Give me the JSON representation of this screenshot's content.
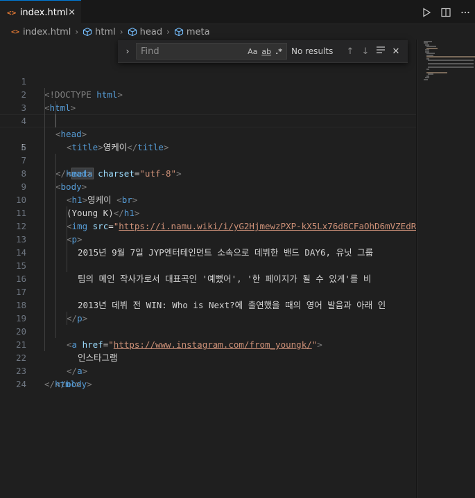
{
  "tab": {
    "icon": "<>",
    "label": "index.html",
    "close": "✕"
  },
  "breadcrumb": [
    "index.html",
    "html",
    "head",
    "meta"
  ],
  "find": {
    "placeholder": "Find",
    "match_case": "Aa",
    "whole_word": "ab",
    "regex": ".*",
    "status": "No results"
  },
  "lines": [
    {
      "n": "1"
    },
    {
      "n": "2"
    },
    {
      "n": "3"
    },
    {
      "n": "4"
    },
    {
      "n": "5"
    },
    {
      "n": "6"
    },
    {
      "n": "7"
    },
    {
      "n": "8"
    },
    {
      "n": "9"
    },
    {
      "n": "10"
    },
    {
      "n": "11"
    },
    {
      "n": "12"
    },
    {
      "n": "13"
    },
    {
      "n": "14"
    },
    {
      "n": "15"
    },
    {
      "n": "16"
    },
    {
      "n": "17"
    },
    {
      "n": "18"
    },
    {
      "n": "19"
    },
    {
      "n": "20"
    },
    {
      "n": "21"
    },
    {
      "n": "22"
    },
    {
      "n": "23"
    },
    {
      "n": "24"
    }
  ],
  "code": {
    "l1_doctype": "<!DOCTYPE ",
    "l1_html": "html",
    "l1_close": ">",
    "l2_open": "<",
    "l2_tag": "html",
    "l2_close": ">",
    "l3_open": "<",
    "l3_tag": "head",
    "l3_close": ">",
    "l4_open": "<",
    "l4_tag": "title",
    "l4_close": ">",
    "l4_text": "영케이",
    "l4_end_open": "</",
    "l4_end_tag": "title",
    "l4_end_close": ">",
    "l5_open": "<",
    "l5_tag": "meta",
    "l5_attr": "charset",
    "l5_eq": "=",
    "l5_val": "\"utf-8\"",
    "l5_close": ">",
    "l6_open": "</",
    "l6_tag": "head",
    "l6_close": ">",
    "l7_open": "<",
    "l7_tag": "body",
    "l7_close": ">",
    "l8_open": "<",
    "l8_tag": "h1",
    "l8_close": ">",
    "l8_text": "영케이 ",
    "l8_br_open": "<",
    "l8_br_tag": "br",
    "l8_br_close": ">",
    "l9_text": "(Young K)",
    "l9_end_open": "</",
    "l9_end_tag": "h1",
    "l9_end_close": ">",
    "l10_open": "<",
    "l10_tag": "img",
    "l10_attr": "src",
    "l10_eq": "=",
    "l10_url": "https://i.namu.wiki/i/yG2HjmewzPXP-kX5Lx76d8CFaOhD6mVZEdR",
    "l11_open": "<",
    "l11_tag": "p",
    "l11_close": ">",
    "l12_text": "2015년 9월 7일 JYP엔터테인먼트 소속으로 데뷔한 밴드 DAY6, 유닛 그룹",
    "l14_text": "팀의 메인 작사가로서 대표곡인 '예뻤어', '한 페이지가 될 수 있게'를 비",
    "l16_text": "2013년 데뷔 전 WIN: Who is Next?에 출연했을 때의 영어 발음과 아래 인",
    "l17_open": "</",
    "l17_tag": "p",
    "l17_close": ">",
    "l19_open": "<",
    "l19_tag": "a",
    "l19_attr": "href",
    "l19_eq": "=",
    "l19_q1": "\"",
    "l19_url": "https://www.instagram.com/from_youngk/",
    "l19_q2": "\"",
    "l19_close": ">",
    "l20_text": "인스타그램",
    "l21_open": "</",
    "l21_tag": "a",
    "l21_close": ">",
    "l22_open": "</",
    "l22_tag": "body",
    "l22_close": ">",
    "l23_open": "</",
    "l23_tag": "html",
    "l23_close": ">"
  },
  "colors": {
    "tag": "#569cd6",
    "attr": "#9cdcfe",
    "string": "#ce9178",
    "bracket": "#808080",
    "text": "#d4d4d4",
    "accent": "#0078d4",
    "html_icon": "#e37933"
  }
}
